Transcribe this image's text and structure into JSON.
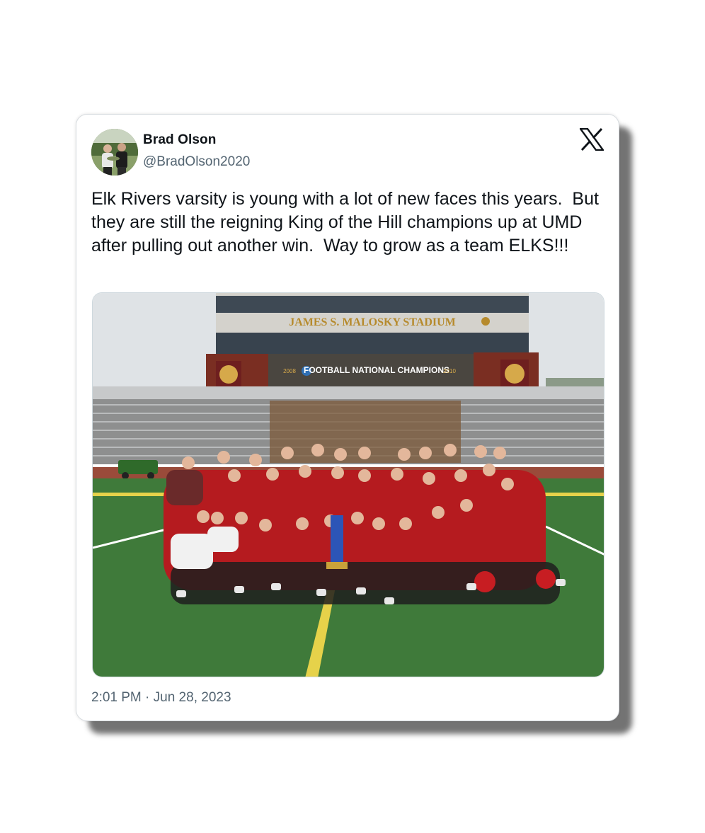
{
  "tweet": {
    "author": {
      "display_name": "Brad Olson",
      "handle": "@BradOlson2020",
      "avatar_icon": "profile-photo-avatar"
    },
    "platform_icon": "x-logo-icon",
    "text": "Elk Rivers varsity is young with a lot of new faces this years.  But they are still the reigning King of the Hill champions up at UMD after pulling out another win.  Way to grow as a team ELKS!!!",
    "timestamp": "2:01 PM · Jun 28, 2023",
    "photo": {
      "stadium_sign": "JAMES S. MALOSKY STADIUM",
      "banner_text": "FOOTBALL NATIONAL CHAMPIONS",
      "banner_year_left": "2008",
      "banner_year_right": "2010"
    }
  },
  "colors": {
    "text_primary": "#0f1419",
    "text_secondary": "#536471",
    "card_border": "#d9dde1",
    "jersey_red": "#c8161d",
    "turf_green": "#3f7a3a"
  }
}
